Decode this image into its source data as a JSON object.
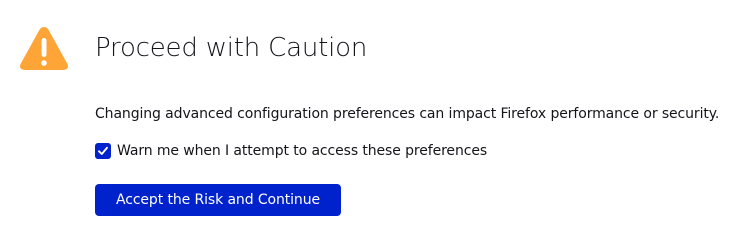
{
  "colors": {
    "warning": "#ffa436",
    "accent": "#0022cc",
    "text": "#15141a"
  },
  "icons": {
    "warning": "warning-triangle-icon",
    "check": "checkmark-icon"
  },
  "page": {
    "title": "Proceed with Caution",
    "description": "Changing advanced configuration preferences can impact Firefox performance or security.",
    "checkbox": {
      "label": "Warn me when I attempt to access these preferences",
      "checked": true
    },
    "accept_button_label": "Accept the Risk and Continue"
  }
}
